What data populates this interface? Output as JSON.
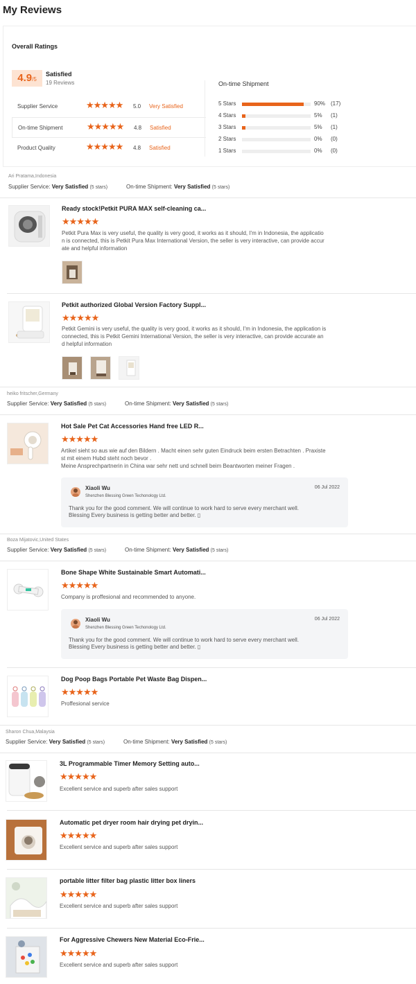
{
  "page": {
    "title": "My Reviews"
  },
  "overall": {
    "heading": "Overall Ratings",
    "score": "4.9",
    "score_suffix": "/5",
    "label": "Satisfied",
    "review_count": "19 Reviews",
    "metrics": [
      {
        "name": "Supplier Service",
        "stars": "★★★★★",
        "score": "5.0",
        "text": "Very Satisfied"
      },
      {
        "name": "On-time Shipment",
        "stars": "★★★★★",
        "score": "4.8",
        "text": "Satisfied"
      },
      {
        "name": "Product Quality",
        "stars": "★★★★★",
        "score": "4.8",
        "text": "Satisfied"
      }
    ],
    "shipment": {
      "title": "On-time Shipment",
      "rows": [
        {
          "label": "5 Stars",
          "percent": "90%",
          "count": "(17)",
          "fill": 0.9
        },
        {
          "label": "4 Stars",
          "percent": "5%",
          "count": "(1)",
          "fill": 0.05
        },
        {
          "label": "3 Stars",
          "percent": "5%",
          "count": "(1)",
          "fill": 0.05
        },
        {
          "label": "2 Stars",
          "percent": "0%",
          "count": "(0)",
          "fill": 0
        },
        {
          "label": "1 Stars",
          "percent": "0%",
          "count": "(0)",
          "fill": 0
        }
      ]
    }
  },
  "accent_color": "#e8641b",
  "labels": {
    "supplier_service": "Supplier Service:",
    "on_time_shipment": "On-time Shipment:",
    "very_satisfied": "Very Satisfied",
    "five_stars": "(5 stars)",
    "stars": "★★★★★"
  },
  "reviewers": [
    {
      "name": "Ari Pratama,Indonesia",
      "items": [
        {
          "title": "Ready stock!Petkit PURA MAX self-cleaning ca...",
          "text_lines": [
            "Petkit Pura Max is very useful, the quality is very good, it works as it should, I'm in Indonesia, the applicatio",
            "n is connected, this is Petkit Pura Max International Version, the seller is very interactive, can provide accur",
            "ate and helpful information"
          ]
        },
        {
          "title": "Petkit authorized Global Version Factory Suppl...",
          "text_lines": [
            "Petkit Gemini is very useful, the quality is very good, it works as it should, I'm in Indonesia, the application is",
            "connected, this is Petkit Gemini International Version, the seller is very interactive, can provide accurate an",
            "d helpful information"
          ]
        }
      ]
    },
    {
      "name": "heiko fritscher,Germany",
      "items": [
        {
          "title": "Hot Sale Pet Cat Accessories Hand free LED R...",
          "text_lines": [
            "Artikel sieht so aus wie auf den Bildern . Macht einen sehr guten Eindruck beim ersten Betrachten . Praxiste",
            "st mit einem Hubd steht noch bevor .",
            "Meine Ansprechpartnerin in China war sehr nett und schnell beim Beantworten meiner Fragen ."
          ],
          "reply": {
            "name": "Xiaoli Wu",
            "company": "Shenzhen Blessing Green Techonology Ltd.",
            "date": "06 Jul 2022",
            "line1": "Thank you for the good comment. We will continue to work hard to serve every merchant well.",
            "line2": "Blessing Every business is getting better and better. ▯"
          }
        }
      ]
    },
    {
      "name": "Boza Mijatovic,United States",
      "items": [
        {
          "title": "Bone Shape White Sustainable Smart Automati...",
          "text_lines": [
            "Company is proffesional and recommended to anyone."
          ],
          "reply": {
            "name": "Xiaoli Wu",
            "company": "Shenzhen Blessing Green Techonology Ltd.",
            "date": "06 Jul 2022",
            "line1": "Thank you for the good comment. We will continue to work hard to serve every merchant well.",
            "line2": "Blessing Every business is getting better and better. ▯"
          }
        },
        {
          "title": "Dog Poop Bags Portable Pet Waste Bag Dispen...",
          "text_lines": [
            "Proffesional service"
          ]
        }
      ]
    },
    {
      "name": "Sharon Chua,Malaysia",
      "items": [
        {
          "title": "3L Programmable Timer Memory Setting auto...",
          "text_lines": [
            "Excellent service and superb after sales support"
          ]
        },
        {
          "title": "Automatic pet dryer room hair drying pet dryin...",
          "text_lines": [
            "Excellent service and superb after sales support"
          ]
        },
        {
          "title": "portable litter filter bag plastic litter box liners",
          "text_lines": [
            "Excellent service and superb after sales support"
          ]
        },
        {
          "title": "For Aggressive Chewers New Material Eco-Frie...",
          "text_lines": [
            "Excellent service and superb after sales support"
          ]
        }
      ]
    }
  ]
}
